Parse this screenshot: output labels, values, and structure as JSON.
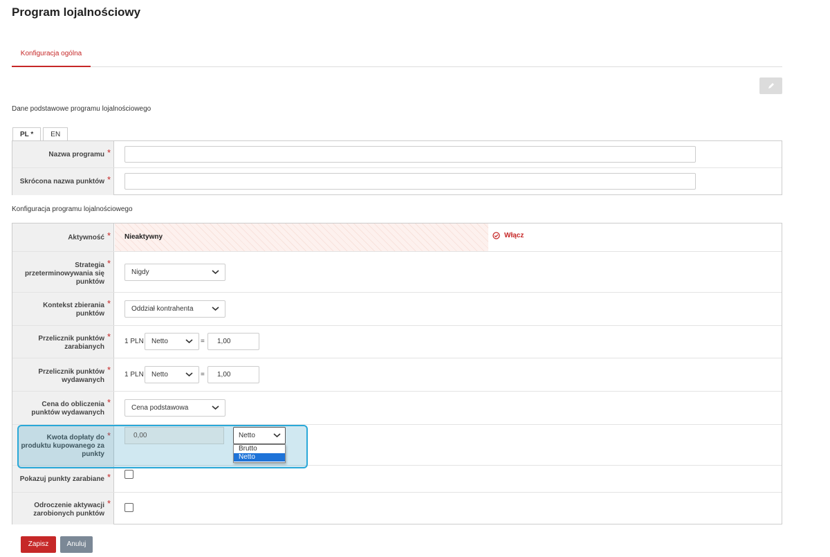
{
  "page": {
    "title": "Program lojalnościowy"
  },
  "tabs": {
    "active_label": "Konfiguracja ogólna"
  },
  "toolbar": {
    "edit_icon": "pencil-icon"
  },
  "section_basic": {
    "title": "Dane podstawowe programu lojalnościowego",
    "lang_tabs": [
      "PL *",
      "EN"
    ],
    "fields": {
      "program_name": {
        "label": "Nazwa programu",
        "value": ""
      },
      "points_short_name": {
        "label": "Skrócona nazwa punktów",
        "value": ""
      }
    }
  },
  "section_config": {
    "title": "Konfiguracja programu lojalnościowego",
    "activity": {
      "label": "Aktywność",
      "status": "Nieaktywny",
      "enable_label": "Włącz"
    },
    "expiry_strategy": {
      "label": "Strategia przeterminowywania się punktów",
      "value": "Nigdy"
    },
    "collection_context": {
      "label": "Kontekst zbierania punktów",
      "value": "Oddział kontrahenta"
    },
    "earn_ratio": {
      "label": "Przelicznik punktów zarabianych",
      "unit": "1 PLN",
      "price_type": "Netto",
      "eq": "=",
      "value": "1,00"
    },
    "spend_ratio": {
      "label": "Przelicznik punktów wydawanych",
      "unit": "1 PLN",
      "price_type": "Netto",
      "eq": "=",
      "value": "1,00"
    },
    "spend_price": {
      "label": "Cena do obliczenia punktów wydawanych",
      "value": "Cena podstawowa"
    },
    "surcharge": {
      "label": "Kwota dopłaty do produktu kupowanego za punkty",
      "amount": "0,00",
      "price_type": "Netto",
      "options": [
        "Brutto",
        "Netto"
      ]
    },
    "show_earned": {
      "label": "Pokazuj punkty zarabiane",
      "checked": false
    },
    "delay_activation": {
      "label": "Odroczenie aktywacji zarobionych punktów",
      "checked": false
    }
  },
  "actions": {
    "save_label": "Zapisz",
    "cancel_label": "Anuluj"
  },
  "colors": {
    "accent": "#c62828",
    "highlight": "#29a8d8",
    "selected_option": "#1e73d8"
  }
}
